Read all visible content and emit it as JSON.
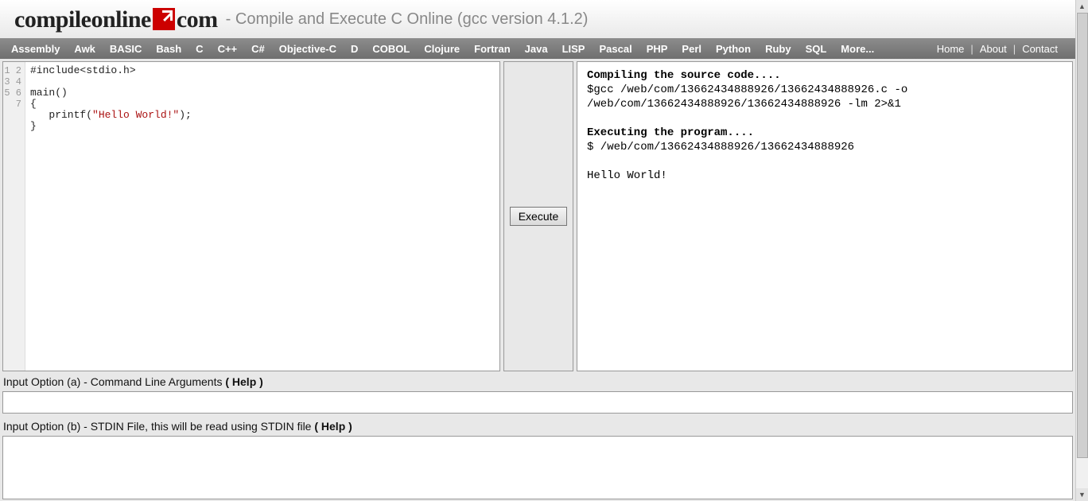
{
  "header": {
    "logo_part1": "compileonline",
    "logo_part2": "com",
    "tagline": "- Compile and Execute C Online (gcc version 4.1.2)"
  },
  "nav": {
    "items": [
      "Assembly",
      "Awk",
      "BASIC",
      "Bash",
      "C",
      "C++",
      "C#",
      "Objective-C",
      "D",
      "COBOL",
      "Clojure",
      "Fortran",
      "Java",
      "LISP",
      "Pascal",
      "PHP",
      "Perl",
      "Python",
      "Ruby",
      "SQL",
      "More..."
    ],
    "right": [
      "Home",
      "About",
      "Contact"
    ]
  },
  "editor": {
    "line_numbers": [
      "1",
      "2",
      "3",
      "4",
      "5",
      "6",
      "7"
    ],
    "code_lines": [
      {
        "plain": "#include<stdio.h>"
      },
      {
        "plain": ""
      },
      {
        "plain": "main()"
      },
      {
        "plain": "{"
      },
      {
        "indent": "   ",
        "call": "printf(",
        "str": "\"Hello World!\"",
        "tail": ");"
      },
      {
        "plain": "}"
      },
      {
        "plain": ""
      }
    ]
  },
  "execute": {
    "label": "Execute"
  },
  "output": {
    "line1_bold": "Compiling the source code....",
    "line2": "$gcc /web/com/13662434888926/13662434888926.c -o /web/com/13662434888926/13662434888926 -lm 2>&1",
    "blank1": "",
    "line3_bold": "Executing the program....",
    "line4": "$ /web/com/13662434888926/13662434888926",
    "blank2": "",
    "line5": "Hello World!"
  },
  "options": {
    "a_prefix": "Input Option (a) - Command Line Arguments ",
    "a_help": "( Help )",
    "a_value": "",
    "b_prefix": "Input Option (b) - STDIN File, this will be read using STDIN file ",
    "b_help": "( Help )",
    "b_value": ""
  }
}
